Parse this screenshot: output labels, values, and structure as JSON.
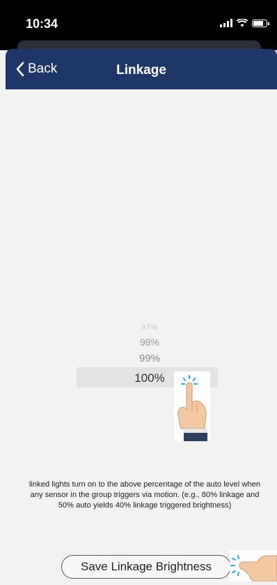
{
  "status_bar": {
    "time": "10:34"
  },
  "nav": {
    "back_label": "Back",
    "title": "Linkage"
  },
  "picker": {
    "options": [
      "97%",
      "98%",
      "99%",
      "100%"
    ],
    "selected": "100%"
  },
  "description": "linked lights turn on to the above percentage of the auto level when any sensor in the group triggers via motion. (e.g., 80% linkage and 50% auto yields 40% linkage triggered brightness)",
  "save_button_label": "Save Linkage Brightness",
  "colors": {
    "nav_bg": "#1e3768",
    "tap_accent": "#29a8e0"
  }
}
